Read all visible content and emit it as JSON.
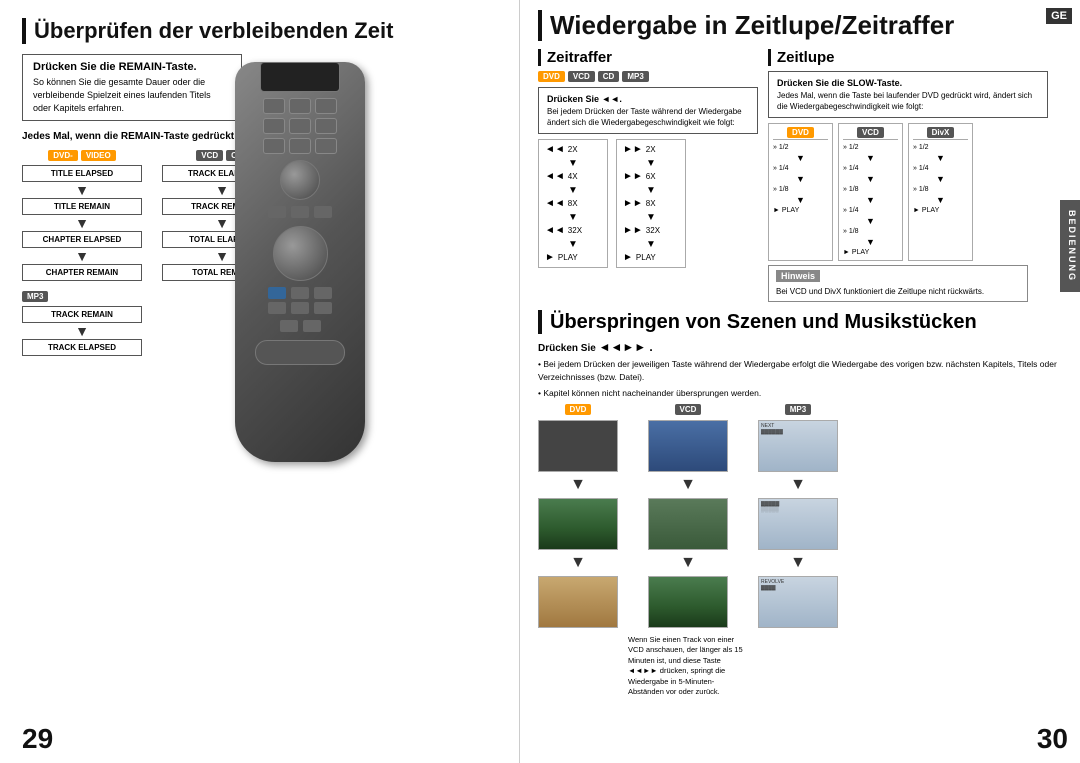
{
  "left": {
    "section_title": "Überprüfen der verbleibenden Zeit",
    "info_box": {
      "title": "Drücken Sie die REMAIN-Taste.",
      "desc": "So können Sie die gesamte Dauer oder die verbleibende Spielzeit eines laufenden Titels oder Kapitels erfahren."
    },
    "sub_heading": "Jedes Mal, wenn die REMAIN-Taste gedrückt wird",
    "dvd_video_label": "DVD-VIDEO",
    "vcd_label": "VCD",
    "cd_label": "CD",
    "mp3_label": "MP3",
    "flow_left": [
      "TITLE ELAPSED",
      "TITLE REMAIN",
      "CHAPTER ELAPSED",
      "CHAPTER REMAIN"
    ],
    "flow_right": [
      "TRACK ELAPSED",
      "TRACK REMAIN",
      "TOTAL ELAPSED",
      "TOTAL REMAIN"
    ],
    "flow_mp3": [
      "TRACK REMAIN",
      "TRACK ELAPSED"
    ],
    "page_num": "29"
  },
  "right": {
    "section_title": "Wiedergabe in Zeitlupe/Zeitraffer",
    "ge_badge": "GE",
    "zeitraffer": {
      "title": "Zeitraffer",
      "badges": [
        "DVD",
        "VCD",
        "CD",
        "MP3"
      ],
      "instruction_title": "Drücken Sie ◄◄.",
      "instruction_desc": "Bei jedem Drücken der Taste während der Wiedergabe ändert sich die Wiedergabegeschwindigkeit wie folgt:",
      "speeds_left": [
        "◄◄ 2X",
        "◄◄ 4X",
        "◄◄ 8X",
        "◄◄ 32X",
        "► PLAY"
      ],
      "speeds_right": [
        "►► 2X",
        "►► 6X",
        "►► 8X",
        "►► 32X",
        "► PLAY"
      ]
    },
    "zeitlupe": {
      "title": "Zeitlupe",
      "instruction_title": "Drücken Sie die SLOW-Taste.",
      "instruction_desc": "Jedes Mal, wenn die Taste bei laufender DVD gedrückt wird, ändert sich die Wiedergabegeschwindigkeit wie folgt:",
      "dvd_label": "DVD",
      "vcd_label": "VCD",
      "divx_label": "DivX",
      "hinweis_title": "Hinweis",
      "hinweis_text": "Bei VCD und DivX funktioniert die Zeitlupe nicht rückwärts.",
      "speeds_dvd": [
        "» 1/2",
        "» 1/4",
        "» 1/8",
        "► PLAY"
      ],
      "speeds_vcd": [
        "» 1/2",
        "» 1/4",
        "» 1/8",
        "» 1/4",
        "» 1/8",
        "► PLAY"
      ],
      "speeds_divx": [
        "» 1/2",
        "» 1/4",
        "» 1/8",
        "► PLAY"
      ]
    },
    "scene_skip": {
      "title": "Überspringen von Szenen und Musikstücken",
      "instruction": "Drücken Sie ◄◄►► .",
      "bullets": [
        "Bei jedem Drücken der jeweiligen Taste während der Wiedergabe erfolgt die Wiedergabe des vorigen bzw. nächsten Kapitels, Titels oder Verzeichnisses (bzw. Datei).",
        "Kapitel können nicht nacheinander übersprungen werden."
      ],
      "dvd_label": "DVD",
      "vcd_label": "VCD",
      "mp3_label": "MP3",
      "thumb_note": "Wenn Sie einen Track von einer VCD anschauen, der länger als 15 Minuten ist, und diese Taste ◄◄►► drücken, springt die Wiedergabe in 5-Minuten-Abständen vor oder zurück."
    },
    "page_num": "30",
    "bedienung": "BEDIENUNG"
  }
}
